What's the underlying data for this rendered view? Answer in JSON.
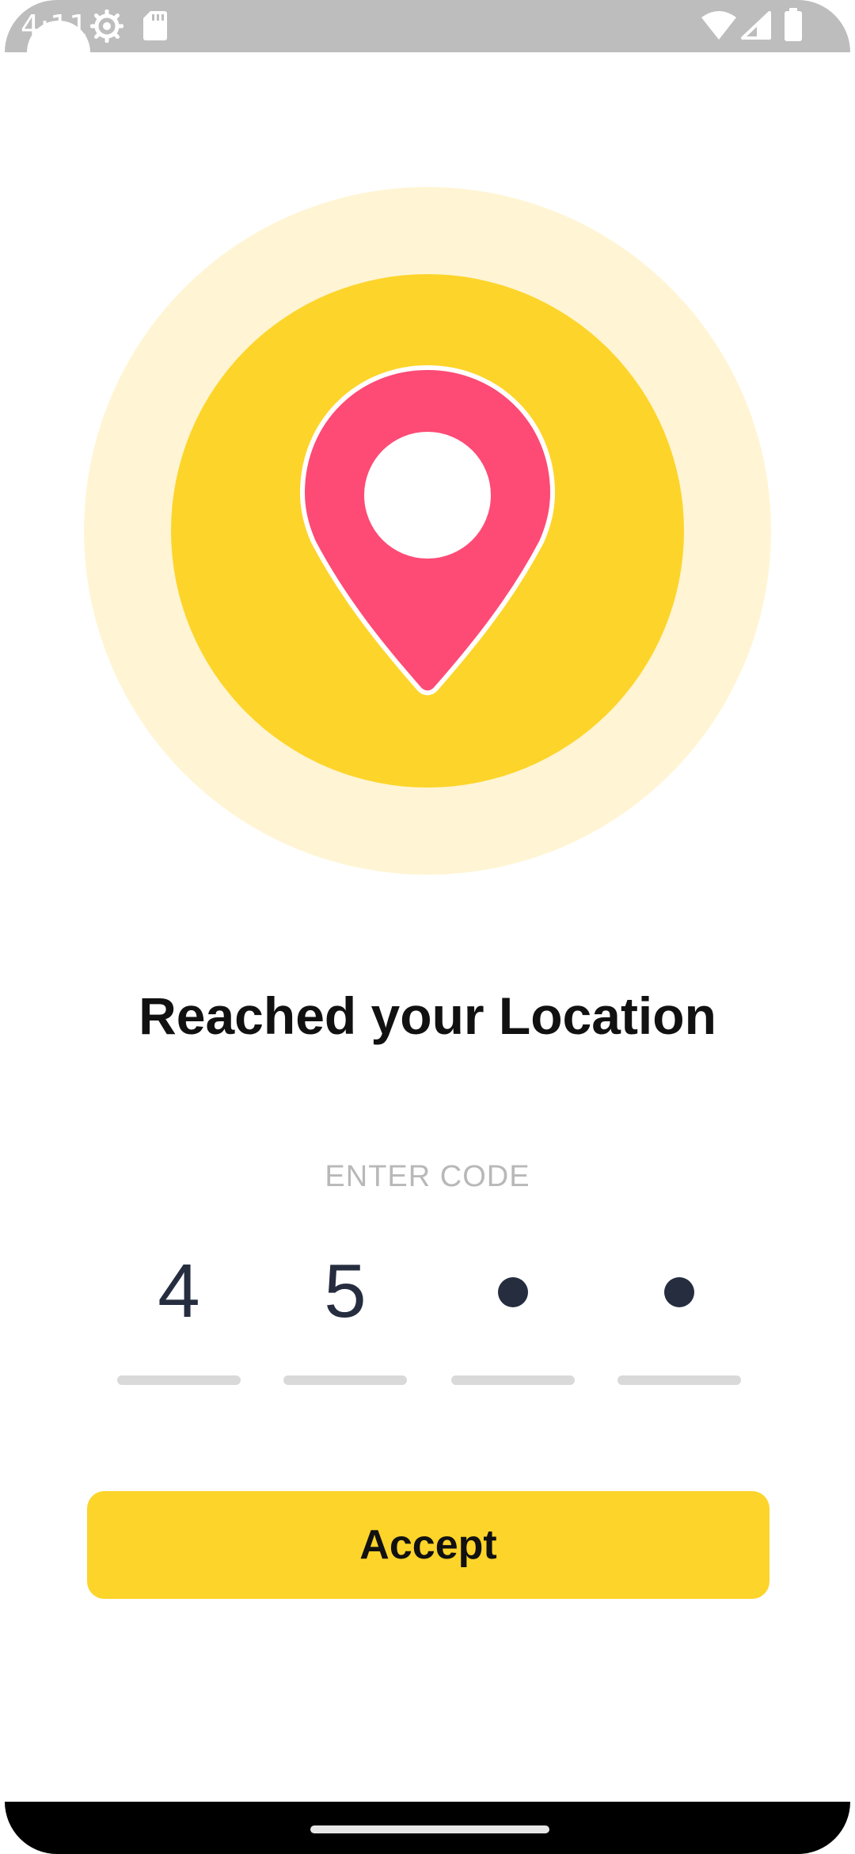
{
  "status_bar": {
    "time": "4:11",
    "icons": [
      "settings-gear-icon",
      "sd-card-icon",
      "wifi-icon",
      "cell-signal-icon",
      "battery-icon"
    ]
  },
  "illustration": {
    "icon": "location-pin-icon",
    "colors": {
      "outer_ring": "#fff5d4",
      "inner_circle": "#fdd42a",
      "pin": "#fd4b75"
    }
  },
  "title": "Reached your Location",
  "code": {
    "label": "ENTER CODE",
    "digits": [
      "4",
      "5",
      "",
      ""
    ]
  },
  "accept_button": {
    "label": "Accept",
    "color": "#fdd42a"
  }
}
